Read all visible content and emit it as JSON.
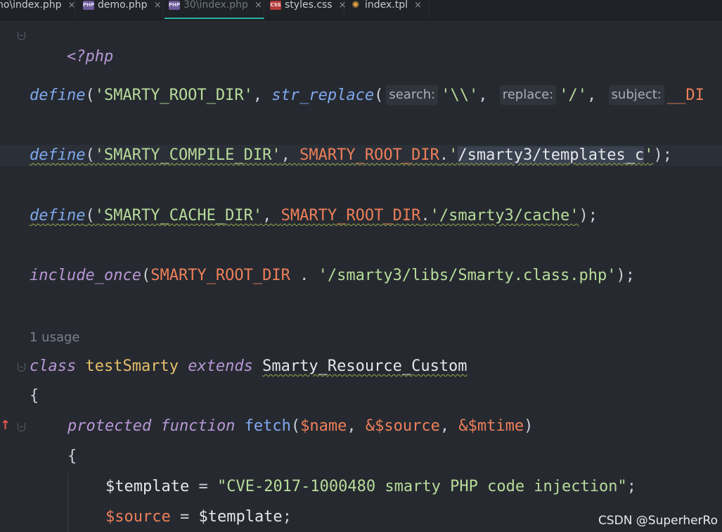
{
  "tabs": [
    {
      "label": "no\\index.php",
      "icon": "php-file-icon",
      "active": false
    },
    {
      "label": "demo.php",
      "icon": "php-file-icon",
      "active": false
    },
    {
      "label": "30\\index.php",
      "icon": "php-file-icon",
      "active": true
    },
    {
      "label": "styles.css",
      "icon": "css-file-icon",
      "active": false
    },
    {
      "label": "index.tpl",
      "icon": "template-file-icon",
      "active": false
    }
  ],
  "tab_close_glyph": "×",
  "tab_icon_text": {
    "php": "PHP",
    "css": "CSS",
    "tpl": "✺"
  },
  "code": {
    "open_tag": "<?php",
    "l1": {
      "fn": "define",
      "const": "'SMARTY_ROOT_DIR'",
      "call": "str_replace",
      "hint_search": "search:",
      "arg_search": "'\\\\'",
      "hint_replace": "replace:",
      "arg_replace": "'/'",
      "hint_subject": "subject:",
      "arg_subject": "__DI"
    },
    "l2": {
      "fn": "define",
      "const": "'SMARTY_COMPILE_DIR'",
      "ref": "SMARTY_ROOT_DIR",
      "dot": ".",
      "str_a": "'",
      "str_sel": "/smarty3/templates_c",
      "str_b": "'",
      "end": ");"
    },
    "l3": {
      "fn": "define",
      "const": "'SMARTY_CACHE_DIR'",
      "ref": "SMARTY_ROOT_DIR",
      "dot": ".",
      "str": "'/smarty3/cache'",
      "end": ");"
    },
    "l4": {
      "fn": "include_once",
      "ref": "SMARTY_ROOT_DIR",
      "dot": " . ",
      "str": "'/smarty3/libs/Smarty.class.php'",
      "end": ");"
    },
    "usage": "1 usage",
    "l5": {
      "kw": "class",
      "name": "testSmarty",
      "kw2": "extends",
      "parent": "Smarty_Resource_Custom"
    },
    "brace_open": "{",
    "l6": {
      "kw": "protected",
      "kw2": "function",
      "name": "fetch",
      "p1": "$name",
      "p2": "&$source",
      "p3": "&$mtime"
    },
    "inner_brace": "{",
    "l7": {
      "var": "$template",
      "op": " = ",
      "str": "\"CVE-2017-1000480 smarty PHP code injection\"",
      "end": ";"
    },
    "l8": {
      "var": "$source",
      "op": " = ",
      "val": "$template",
      "end": ";"
    }
  },
  "watermark": "CSDN @SuperherRo"
}
